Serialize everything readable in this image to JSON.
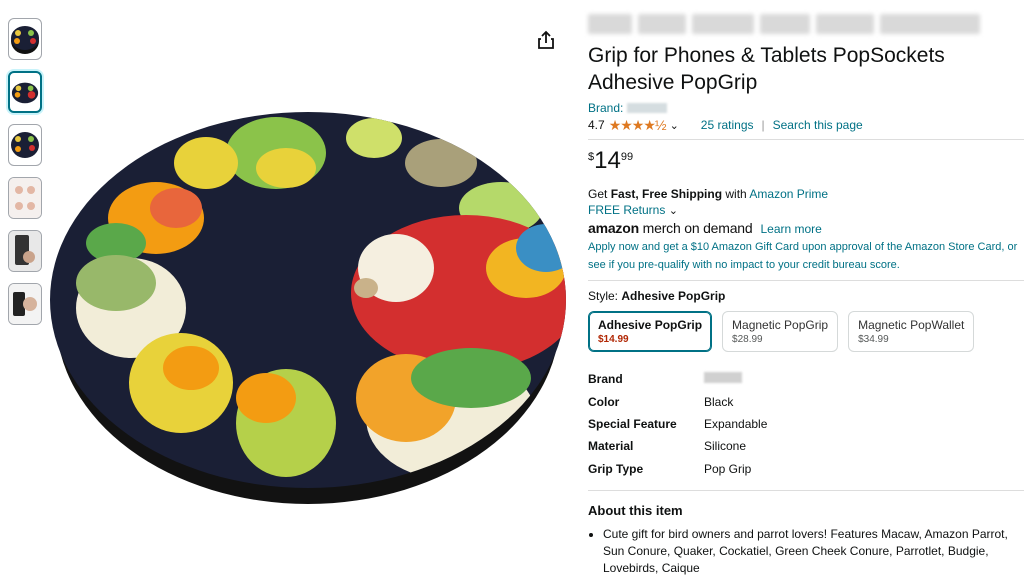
{
  "product": {
    "blurred_top_text": "",
    "title": "Grip for Phones & Tablets PopSockets Adhesive PopGrip",
    "brand_label": "Brand:",
    "rating_value": "4.7",
    "stars": "★★★★½",
    "ratings_link": "25 ratings",
    "search_link": "Search this page",
    "price_symbol": "$",
    "price_whole": "14",
    "price_fraction": "99"
  },
  "shipping": {
    "get": "Get",
    "fast_free": "Fast, Free Shipping",
    "with": "with",
    "prime": "Amazon Prime",
    "free_returns": "FREE Returns",
    "merch_logo_a": "amazon",
    "merch_logo_b": "merch on demand",
    "learn_more": "Learn more",
    "apply_text": "Apply now and get a $10 Amazon Gift Card upon approval of the Amazon Store Card, or see if you pre-qualify with no impact to your credit bureau score."
  },
  "style": {
    "label": "Style:",
    "selected": "Adhesive PopGrip",
    "options": [
      {
        "name": "Adhesive PopGrip",
        "price": "$14.99"
      },
      {
        "name": "Magnetic PopGrip",
        "price": "$28.99"
      },
      {
        "name": "Magnetic PopWallet",
        "price": "$34.99"
      }
    ]
  },
  "specs": [
    {
      "key": "Brand",
      "value": ""
    },
    {
      "key": "Color",
      "value": "Black"
    },
    {
      "key": "Special Feature",
      "value": "Expandable"
    },
    {
      "key": "Material",
      "value": "Silicone"
    },
    {
      "key": "Grip Type",
      "value": "Pop Grip"
    }
  ],
  "about": {
    "heading": "About this item",
    "bullets": [
      "Cute gift for bird owners and parrot lovers! Features Macaw, Amazon Parrot, Sun Conure, Quaker, Cockatiel, Green Cheek Conure, Parrotlet, Budgie, Lovebirds, Caique"
    ]
  },
  "icons": {
    "share": "share-icon",
    "chevron": "chevron-down-icon",
    "star": "star-icon"
  },
  "colors": {
    "link": "#007185",
    "star": "#de7921",
    "price_red": "#b12704",
    "popgrip_bg": "#1a1f35"
  }
}
